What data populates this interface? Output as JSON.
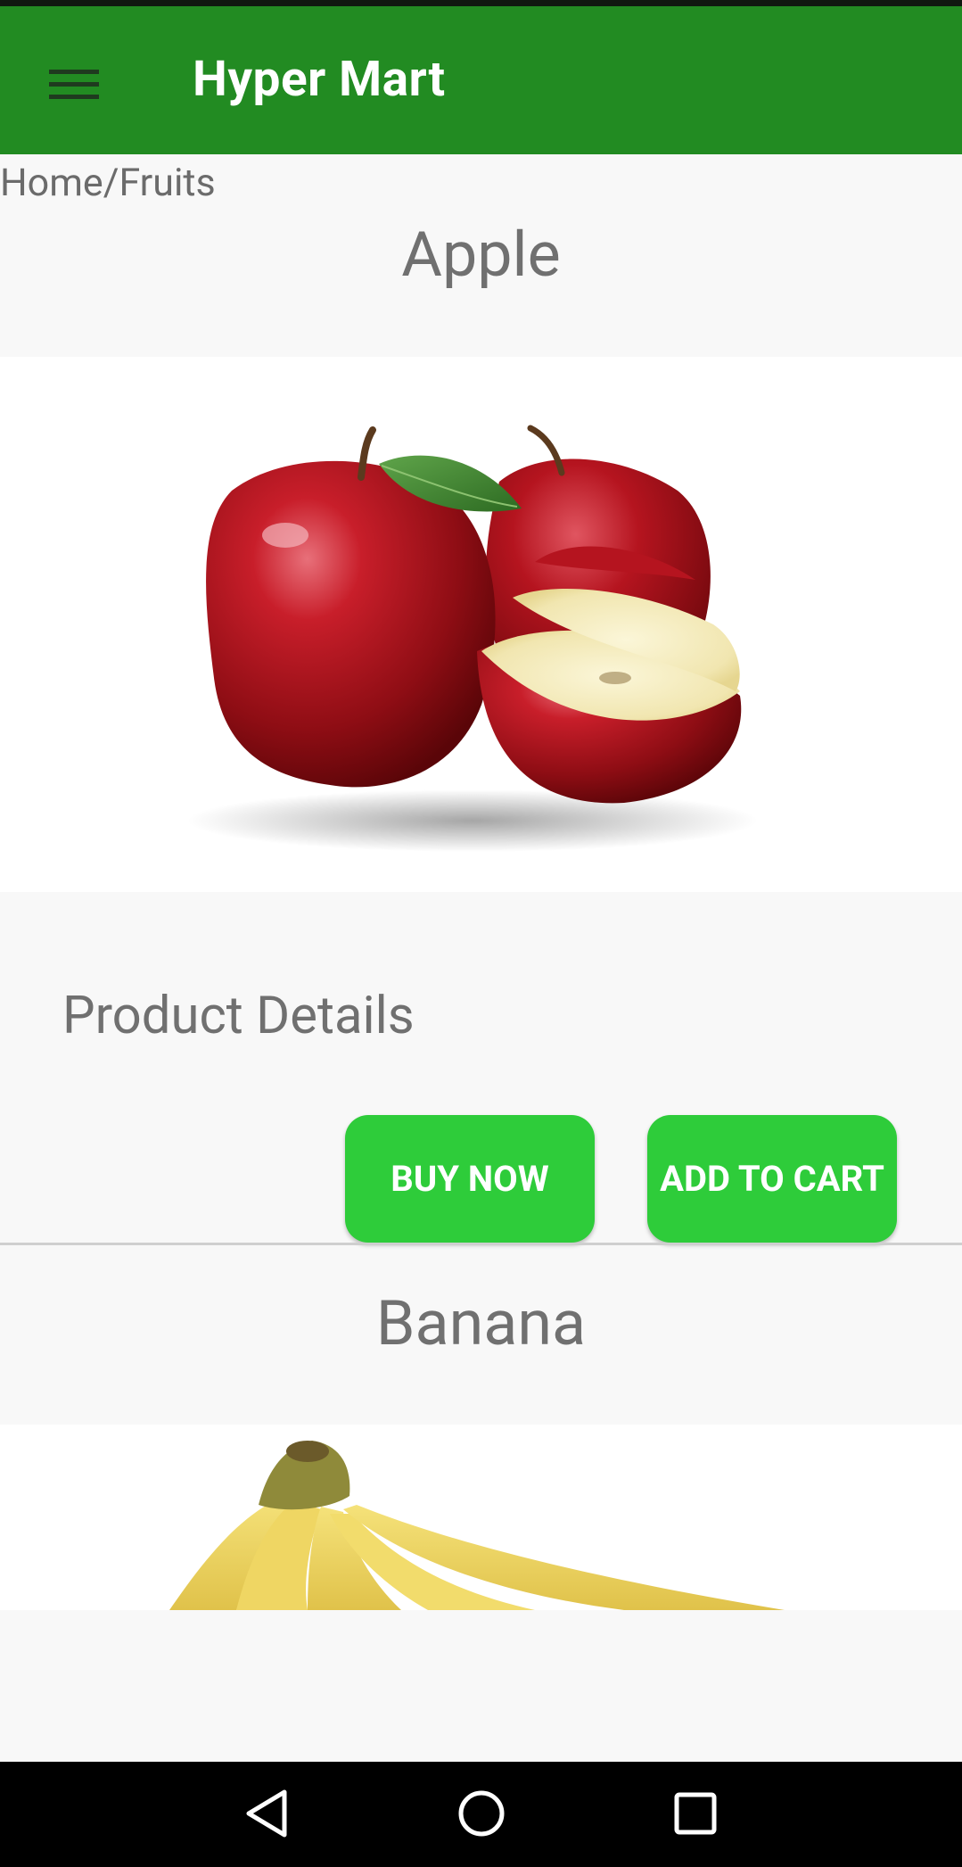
{
  "app": {
    "title": "Hyper Mart"
  },
  "breadcrumb": "Home/Fruits",
  "products": [
    {
      "name": "Apple",
      "details_label": "Product Details",
      "buy_now_label": "BUY NOW",
      "add_to_cart_label": "ADD TO CART"
    },
    {
      "name": "Banana"
    }
  ],
  "colors": {
    "appbar": "#228b22",
    "button": "#2ecc3a",
    "page_background": "#f8f8f8",
    "text_gray": "#707070"
  },
  "icons": {
    "menu": "hamburger-icon",
    "nav_back": "triangle-back-icon",
    "nav_home": "circle-home-icon",
    "nav_recents": "square-recents-icon"
  }
}
